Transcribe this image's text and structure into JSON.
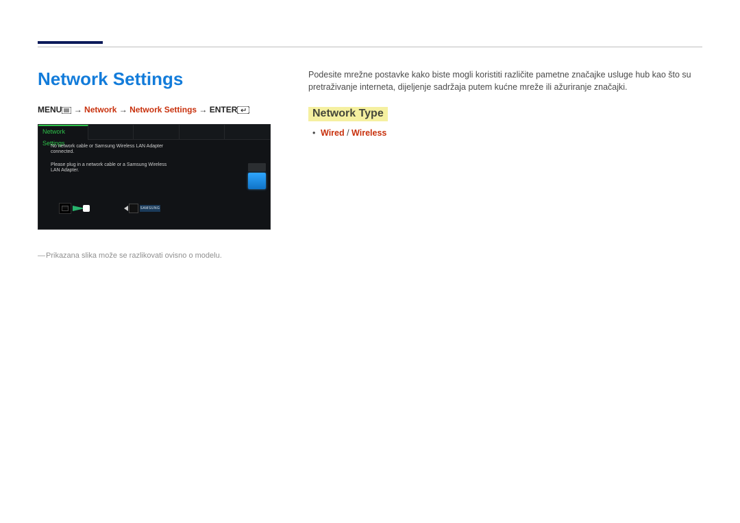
{
  "header": {
    "section_title": "Network Settings"
  },
  "path": {
    "menu_label": "MENU",
    "step1": "Network",
    "step2": "Network Settings",
    "enter_label": "ENTER"
  },
  "screenshot": {
    "tab_active": "Network Settings",
    "message1": "No network cable or Samsung Wireless LAN Adapter connected.",
    "message2": "Please plug in a network cable or a Samsung Wireless LAN Adapter.",
    "adapter_brand": "SAMSUNG"
  },
  "footnote": "Prikazana slika može se razlikovati ovisno o modelu.",
  "right": {
    "paragraph": "Podesite mrežne postavke kako biste mogli koristiti različite pametne značajke usluge hub kao što su pretraživanje interneta, dijeljenje sadržaja putem kućne mreže ili ažuriranje značajki.",
    "subhead": "Network Type",
    "opt_wired": "Wired",
    "opt_sep": " / ",
    "opt_wireless": "Wireless"
  }
}
